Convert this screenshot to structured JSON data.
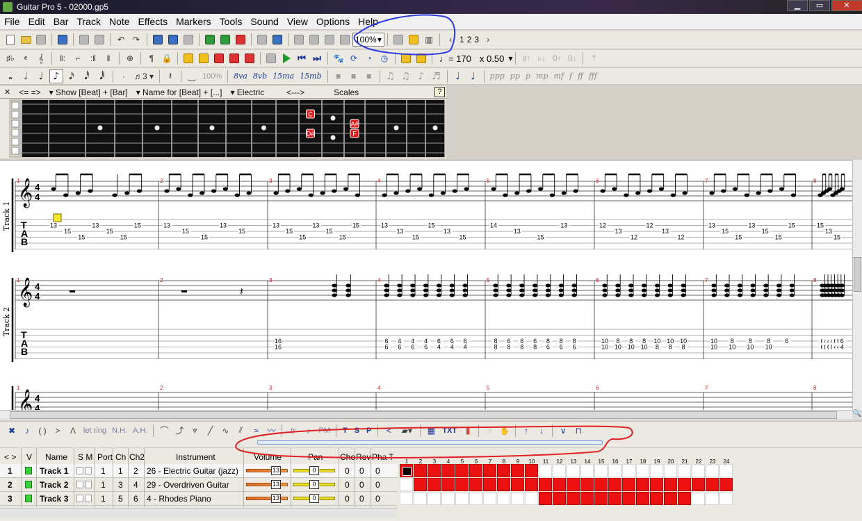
{
  "window": {
    "title": "Guitar Pro 5 - 02000.gp5",
    "controls": [
      "▁",
      "▭",
      "✕"
    ]
  },
  "menu": [
    "File",
    "Edit",
    "Bar",
    "Track",
    "Note",
    "Effects",
    "Markers",
    "Tools",
    "Sound",
    "View",
    "Options",
    "Help"
  ],
  "toolbar": {
    "zoom": "100%",
    "pages": [
      "1",
      "2",
      "3"
    ],
    "tempo": "♩= 170",
    "speed": "x 0.50",
    "mark_100": "100%",
    "dynamics": [
      "ppp",
      "pp",
      "p",
      "mp",
      "mf",
      "f",
      "ff",
      "fff"
    ],
    "ottava": [
      "8va",
      "8vb",
      "15ma",
      "15mb"
    ]
  },
  "fretboard_header": {
    "nav": "<=  =>",
    "show": "Show [Beat] + [Bar]",
    "name": "Name for [Beat] + [...]",
    "instrument": "Electric",
    "range": "<--->",
    "scales": "Scales",
    "help": "?"
  },
  "fretboard_notes": [
    {
      "label": "C",
      "fret": 11,
      "string": 1
    },
    {
      "label": "D#",
      "fret": 11,
      "string": 3
    },
    {
      "label": "A#",
      "fret": 13,
      "string": 2
    },
    {
      "label": "F",
      "fret": 13,
      "string": 3
    }
  ],
  "score": {
    "track_labels": [
      "Track 1",
      "Track 2"
    ],
    "time_sig": [
      "4",
      "4"
    ],
    "tab_clef": [
      "T",
      "A",
      "B"
    ],
    "bars": [
      "1",
      "2",
      "3",
      "4",
      "5",
      "6",
      "7",
      "8"
    ],
    "track1_tab": [
      [
        "13",
        "15",
        "15",
        "13",
        "15",
        "15",
        "15"
      ],
      [
        "13",
        "15",
        "15",
        "13",
        "15"
      ],
      [
        "13",
        "15",
        "15",
        "13",
        "15",
        "15",
        "15"
      ],
      [
        "13",
        "13",
        "15",
        "15",
        "13",
        "15"
      ],
      [
        "14",
        "13",
        "15",
        "13"
      ],
      [
        "12",
        "13",
        "12",
        "12",
        "13",
        "12"
      ],
      [
        "13",
        "15",
        "15",
        "13",
        "15",
        "15",
        "15"
      ],
      [
        "15",
        "13",
        "15"
      ]
    ],
    "track2_tab": [
      [],
      [],
      [
        "16",
        "16"
      ],
      [
        "6",
        "6",
        "4",
        "6",
        "4",
        "6",
        "4",
        "6",
        "6",
        "4",
        "6",
        "4",
        "6",
        "4"
      ],
      [
        "8",
        "8",
        "6",
        "8",
        "6",
        "8",
        "6",
        "8",
        "8",
        "6",
        "8",
        "6",
        "8",
        "6"
      ],
      [
        "10",
        "10",
        "8",
        "10",
        "8",
        "10",
        "8",
        "10",
        "10",
        "8",
        "10",
        "8",
        "10",
        "8"
      ],
      [
        "10",
        "10",
        "8",
        "10",
        "8",
        "10",
        "8",
        "10",
        "6"
      ],
      [
        "6",
        "6",
        "4",
        "6",
        "4",
        "6",
        "4",
        "6",
        "6",
        "4",
        "6",
        "4",
        "6",
        "4"
      ]
    ]
  },
  "effects_bar": {
    "labels": [
      "let ring",
      "N.H.",
      "A.H.",
      "PM",
      "T",
      "S",
      "P",
      "TXT"
    ]
  },
  "tracks": {
    "headers": {
      "arrows": "<  >",
      "v": "V",
      "name": "Name",
      "sm": "S M",
      "port": "Port",
      "ch": "Ch",
      "ch2": "Ch2",
      "instrument": "Instrument",
      "volume": "Volume",
      "pan": "Pan",
      "cho": "Cho",
      "rev": "Rev",
      "pha": "Pha",
      "t": "T"
    },
    "rows": [
      {
        "num": "1",
        "name": "Track 1",
        "port": "1",
        "ch": "1",
        "ch2": "2",
        "instrument": "26 - Electric Guitar (jazz)",
        "volume": "13",
        "pan": "0",
        "cho": "0",
        "rev": "0",
        "pha": "0"
      },
      {
        "num": "2",
        "name": "Track 2",
        "port": "1",
        "ch": "3",
        "ch2": "4",
        "instrument": "29 - Overdriven Guitar",
        "volume": "13",
        "pan": "0",
        "cho": "0",
        "rev": "0",
        "pha": "0"
      },
      {
        "num": "3",
        "name": "Track 3",
        "port": "1",
        "ch": "5",
        "ch2": "6",
        "instrument": "4 - Rhodes Piano",
        "volume": "13",
        "pan": "0",
        "cho": "0",
        "rev": "0",
        "pha": "0"
      }
    ]
  },
  "bar_map": {
    "numbers": [
      "1",
      "2",
      "3",
      "4",
      "5",
      "6",
      "7",
      "8",
      "9",
      "10",
      "11",
      "12",
      "13",
      "14",
      "15",
      "16",
      "17",
      "18",
      "19",
      "20",
      "21",
      "22",
      "23",
      "24"
    ],
    "filled": [
      [
        1,
        2,
        3,
        4,
        5,
        6,
        7,
        8,
        9,
        10
      ],
      [
        2,
        3,
        4,
        5,
        6,
        7,
        8,
        9,
        10,
        11,
        12,
        13,
        14,
        15,
        16,
        17,
        18,
        19,
        20,
        21,
        22,
        23,
        24
      ],
      [
        11,
        12,
        13,
        14,
        15,
        16,
        17,
        18,
        19,
        20,
        21
      ]
    ],
    "cursor": {
      "track": 1,
      "bar": 1
    }
  },
  "colors": {
    "filled_bar": "#ee1111",
    "track_visible": "#3bd13b",
    "annotation_blue": "#2a3ae0",
    "annotation_red": "#e02020",
    "bar_number": "#cc2222"
  }
}
